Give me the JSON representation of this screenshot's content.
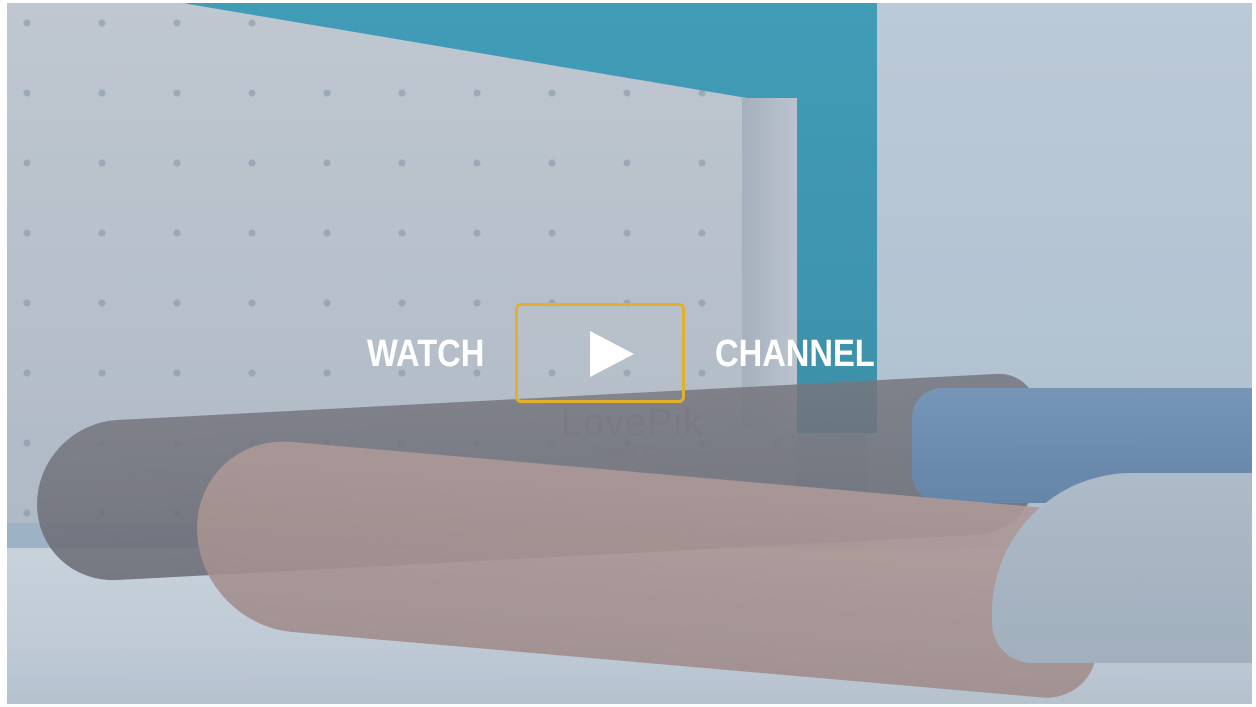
{
  "video": {
    "cta_left": "WATCH",
    "cta_right": "CHANNEL",
    "play_icon": "play-icon"
  },
  "watermark": {
    "logo": "LovePik",
    "url": "lovepik.com"
  },
  "colors": {
    "play_border": "#e3b02b",
    "text": "#ffffff",
    "wall_teal": "#2f98b3"
  }
}
